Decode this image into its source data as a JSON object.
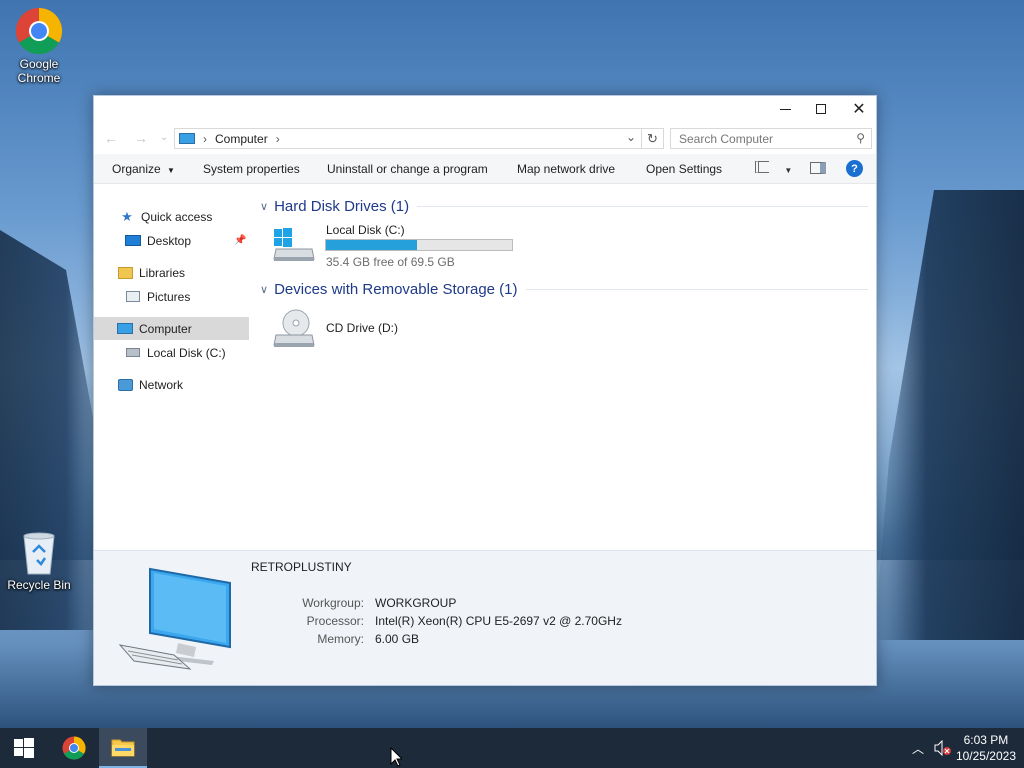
{
  "desktop": {
    "icons": [
      {
        "label_line1": "Google",
        "label_line2": "Chrome",
        "icon": "chrome-icon"
      },
      {
        "label": "Recycle Bin",
        "icon": "recycle-bin-icon"
      }
    ]
  },
  "window": {
    "address": {
      "breadcrumb": "Computer",
      "search_placeholder": "Search Computer"
    },
    "toolbar": {
      "organize": "Organize",
      "system_properties": "System properties",
      "uninstall": "Uninstall or change a program",
      "map_drive": "Map network drive",
      "open_settings": "Open Settings"
    },
    "nav": {
      "quick_access": "Quick access",
      "desktop": "Desktop",
      "libraries": "Libraries",
      "pictures": "Pictures",
      "computer": "Computer",
      "local_disk": "Local Disk (C:)",
      "network": "Network"
    },
    "content": {
      "hdd_group": "Hard Disk Drives (1)",
      "removable_group": "Devices with Removable Storage (1)",
      "local_disk": {
        "name": "Local Disk (C:)",
        "free_text": "35.4 GB free of 69.5 GB",
        "used_fraction": 0.49
      },
      "cd_drive": {
        "name": "CD Drive (D:)"
      }
    },
    "details": {
      "computer_name": "RETROPLUSTINY",
      "workgroup_label": "Workgroup:",
      "workgroup": "WORKGROUP",
      "processor_label": "Processor:",
      "processor": "Intel(R) Xeon(R) CPU E5-2697 v2 @ 2.70GHz",
      "memory_label": "Memory:",
      "memory": "6.00 GB"
    }
  },
  "taskbar": {
    "time": "6:03 PM",
    "date": "10/25/2023",
    "accent": "#26a0da"
  }
}
